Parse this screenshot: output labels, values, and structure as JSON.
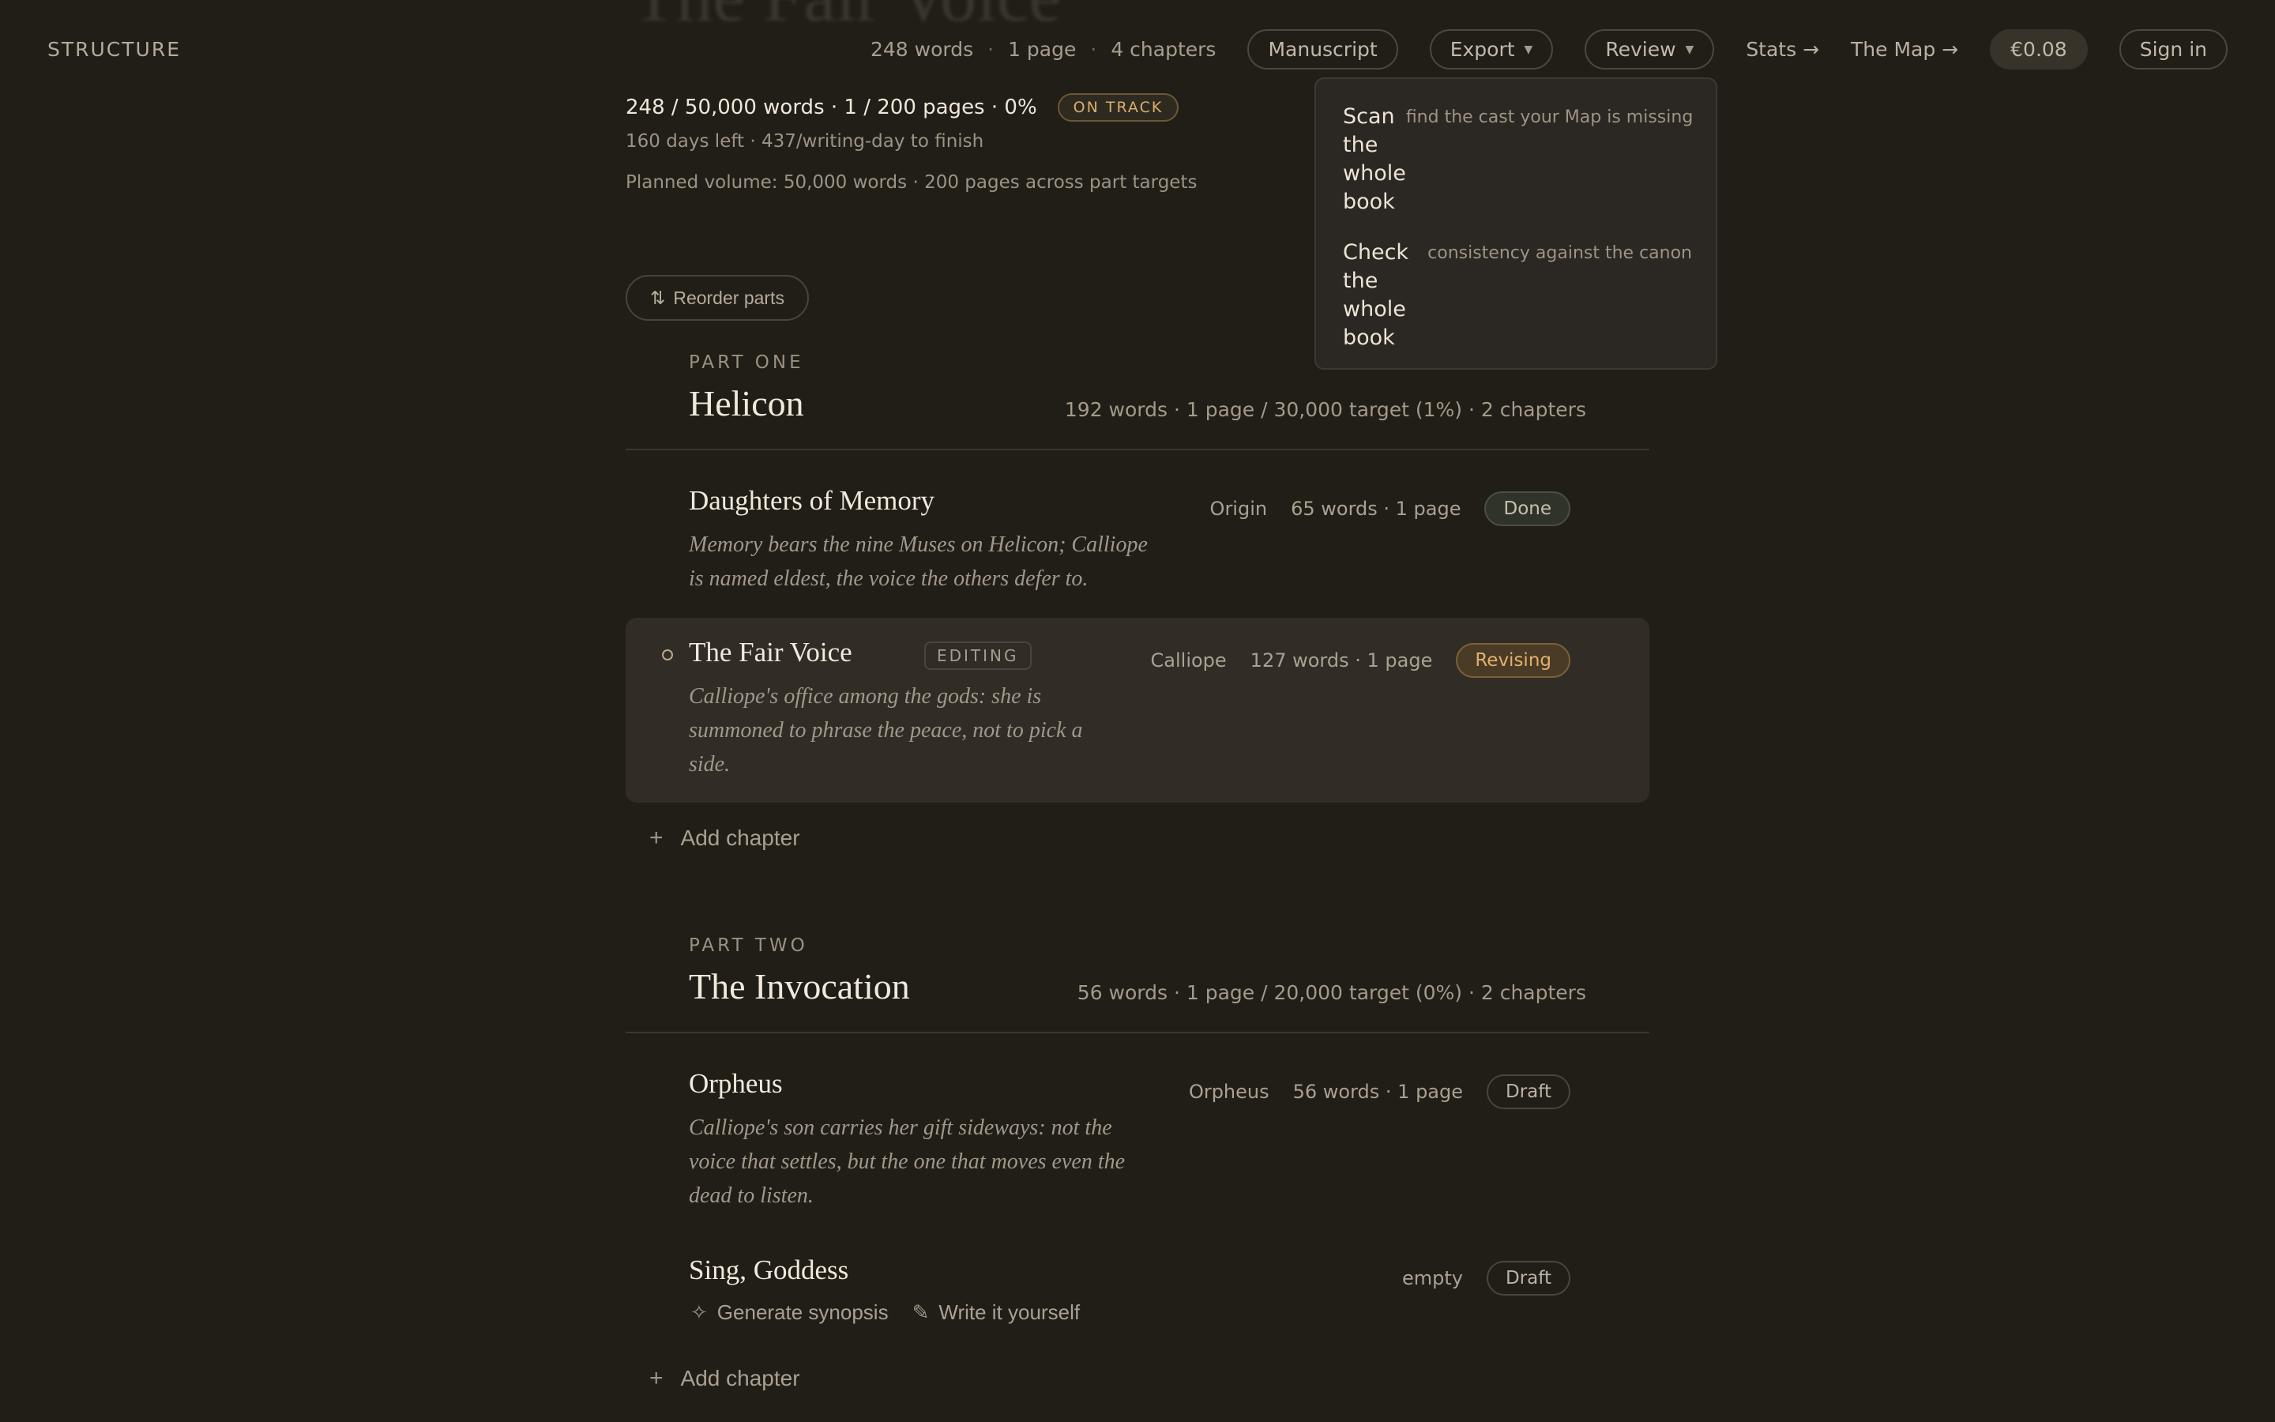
{
  "ghost_title": "The Fair Voice",
  "header": {
    "brand": "STRUCTURE",
    "stats": {
      "words": "248 words",
      "pages": "1 page",
      "chapters": "4 chapters",
      "separator": "·"
    },
    "manuscript": "Manuscript",
    "export": "Export",
    "review": "Review",
    "stats_link": "Stats →",
    "map_link": "The Map →",
    "credit": "€0.08",
    "sign_in": "Sign in"
  },
  "review_menu": {
    "items": [
      {
        "label": "Scan the whole book",
        "hint": "find the cast your Map is missing"
      },
      {
        "label": "Check the whole book",
        "hint": "consistency against the canon"
      }
    ]
  },
  "summary": {
    "progress": "248 / 50,000 words · 1 / 200 pages · 0%",
    "badge": "ON TRACK",
    "days": "160 days left · 437/writing-day to finish",
    "planned": "Planned volume: 50,000 words · 200 pages across part targets"
  },
  "reorder": {
    "icon": "⇅",
    "label": "Reorder parts"
  },
  "parts": [
    {
      "label": "PART ONE",
      "title": "Helicon",
      "stats": "192 words · 1 page / 30,000 target (1%) · 2 chapters",
      "chapters": [
        {
          "title": "Daughters of Memory",
          "synopsis": "Memory bears the nine Muses on Helicon; Calliope is named eldest, the voice the others defer to.",
          "pov": "Origin",
          "count": "65 words · 1 page",
          "status": "Done"
        },
        {
          "title": "The Fair Voice",
          "tag": "EDITING",
          "synopsis": "Calliope's office among the gods: she is summoned to phrase the peace, not to pick a side.",
          "pov": "Calliope",
          "count": "127 words · 1 page",
          "status": "Revising"
        }
      ],
      "add": "Add chapter"
    },
    {
      "label": "PART TWO",
      "title": "The Invocation",
      "stats": "56 words · 1 page / 20,000 target (0%) · 2 chapters",
      "chapters": [
        {
          "title": "Orpheus",
          "synopsis": "Calliope's son carries her gift sideways: not the voice that settles, but the one that moves even the dead to listen.",
          "pov": "Orpheus",
          "count": "56 words · 1 page",
          "status": "Draft"
        },
        {
          "title": "Sing, Goddess",
          "count": "empty",
          "status": "Draft",
          "actions": {
            "generate": "Generate synopsis",
            "write": "Write it yourself"
          }
        }
      ],
      "add": "Add chapter"
    }
  ]
}
